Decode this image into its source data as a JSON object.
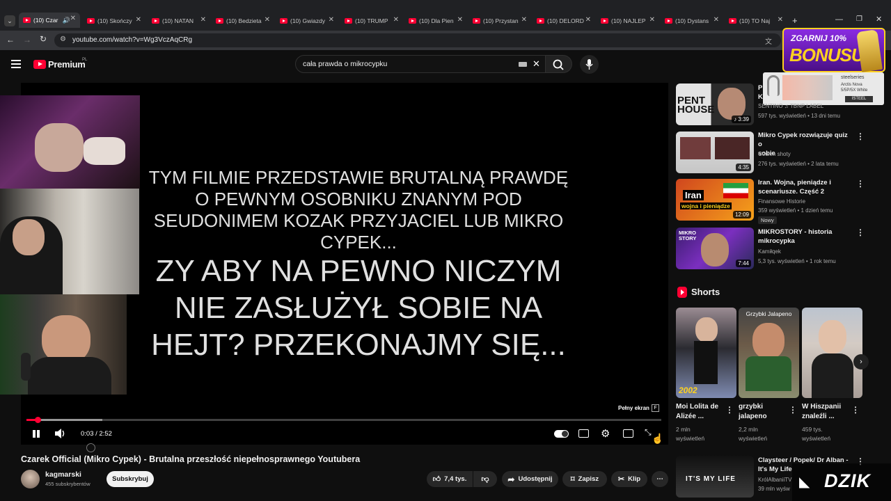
{
  "browser": {
    "tabs": [
      {
        "label": "(10) Czar"
      },
      {
        "label": "(10) Skończy"
      },
      {
        "label": "(10) NATAN"
      },
      {
        "label": "(10) Bedzieta"
      },
      {
        "label": "(10) Gwiazdy"
      },
      {
        "label": "(10) TRUMP"
      },
      {
        "label": "(10) Dla Pien"
      },
      {
        "label": "(10) Przystan"
      },
      {
        "label": "(10) DELORD"
      },
      {
        "label": "(10) NAJLEP"
      },
      {
        "label": "(10) Dystans"
      },
      {
        "label": "(10) TO Naj"
      }
    ],
    "url": "youtube.com/watch?v=Wg3VczAqCRg"
  },
  "header": {
    "logo": "Premium",
    "logo_region": "PL",
    "search_value": "cała prawda o mikrocypku"
  },
  "ad": {
    "line1": "ZGARNIJ 10%",
    "line2": "BONUSU",
    "brand": "steelseries",
    "product1": "Arctis Nova",
    "product2": "5/5P/5X White",
    "store": "ISTEEL"
  },
  "video": {
    "text_lines": [
      "TYM FILMIE PRZEDSTAWIE BRUTALNĄ PRAWDĘ",
      "O PEWNYM OSOBNIKU ZNANYM POD",
      "SEUDONIMEM KOZAK PRZYJACIEL LUB MIKRO",
      "CYPEK..."
    ],
    "big_lines": [
      "ZY ABY NA PEWNO NICZYM",
      "NIE ZASŁUŻYŁ SOBIE NA",
      "HEJT? PRZEKONAJMY SIĘ..."
    ],
    "fullscreen_hint": "Pełny ekran",
    "fullscreen_key": "F",
    "time": "0:03 / 2:52",
    "progress": 0.017,
    "buffered": 0.12
  },
  "meta": {
    "title": "Czarek Official (Mikro Cypek) - Brutalna przeszłość niepełnosprawnego Youtubera",
    "channel": "kagmarski",
    "subs": "455 subskrybentów",
    "subscribe": "Subskrybuj",
    "likes": "7,4 tys.",
    "share": "Udostępnij",
    "save": "Zapisz",
    "clip": "Klip"
  },
  "sidebar": {
    "videos": [
      {
        "title_a": "P",
        "title_b": "K",
        "channel": "SENTINO ♫ TBNP LABEL",
        "stats": "597 tys. wyświetleń • 13 dni temu",
        "duration": "3:39",
        "thumb_text": "PENT HOUSE"
      },
      {
        "title_a": "Mikro Cypek rozwiązuje quiz o",
        "title_b": "sobie",
        "channel": "Codien shoty",
        "stats": "276 tys. wyświetleń • 2 lata temu",
        "duration": "4:35",
        "thumb_text": ""
      },
      {
        "title_a": "Iran. Wojna, pieniądze i",
        "title_b": "scenariusze. Część 2",
        "channel": "Finansowe Historie",
        "stats": "359 wyświetleń • 1 dzień temu",
        "duration": "12:09",
        "badge": "Nowy",
        "thumb_text": "Iran",
        "thumb_sub": "wojna i pieniądze"
      },
      {
        "title_a": "MIKROSTORY - historia",
        "title_b": "mikrocypka",
        "channel": "Kamiłqek",
        "stats": "5,3 tys. wyświetleń • 1 rok temu",
        "duration": "7:44",
        "thumb_text": "MIKRO STORY"
      }
    ],
    "shorts_label": "Shorts",
    "shorts": [
      {
        "t1": "Moi Lolita de",
        "t2": "Alizée ...",
        "v1": "2 mln",
        "v2": "wyświetleń",
        "overlay": "2002"
      },
      {
        "t1": "grzybki",
        "t2": "jalapeno",
        "v1": "2,2 mln",
        "v2": "wyświetleń",
        "overlay": "Grzybki Jalapeno"
      },
      {
        "t1": "W Hiszpanii",
        "t2": "znaleźli ...",
        "v1": "459 tys.",
        "v2": "wyświetleń",
        "overlay": ""
      }
    ],
    "next": {
      "title_a": "Claysteer / Popek/ Dr Alban -",
      "title_b": "It's My Life",
      "channel": "KrólAlbaniiTV",
      "stats": "39 mln wyśw",
      "thumb_text": "IT'S MY LIFE"
    }
  },
  "watermark": "DZIK",
  "colors": {
    "yt_red": "#ff0033",
    "bg": "#0f0f0f",
    "ad_purple": "#6a1fb0",
    "ad_yellow": "#ffd21f"
  }
}
